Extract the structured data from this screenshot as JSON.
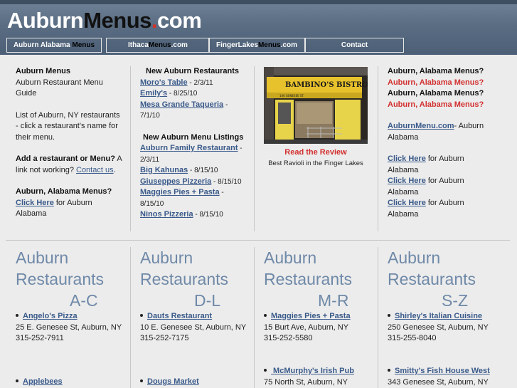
{
  "site": {
    "logo_part1": "Auburn",
    "logo_part2": "Menus",
    "logo_dot": ".",
    "logo_part3": "com"
  },
  "nav": [
    {
      "a": "Auburn ",
      "b": "Alabama ",
      "c": "Menus",
      "d": ""
    },
    {
      "a": "Ithaca",
      "b": "Menus",
      "c": ".com",
      "d": ""
    },
    {
      "a": "FingerLakes",
      "b": "Menus",
      "c": ".com",
      "d": ""
    },
    {
      "a": "Contact",
      "b": "",
      "c": "",
      "d": ""
    }
  ],
  "intro": {
    "title": "Auburn Menus",
    "subtitle": "Auburn Restaurant Menu Guide",
    "list_text": "List of Auburn, NY restaurants - click a restaurant's name for their menu.",
    "add_bold": "Add a restaurant or Menu?",
    "add_text": " A link not working? ",
    "contact_link": "Contact us",
    "period": ".",
    "alabama_bold": "Auburn, Alabama Menus?",
    "click_here": "Click Here",
    "for_auburn_alabama": " for Auburn Alabama"
  },
  "new_restaurants": {
    "heading": "New Auburn Restaurants",
    "items": [
      {
        "name": "Moro's Table",
        "date": " - 2/3/11"
      },
      {
        "name": "Emily's",
        "date": " - 8/25/10"
      },
      {
        "name": "Mesa Grande Taqueria",
        "date": " - 7/1/10"
      }
    ]
  },
  "new_listings": {
    "heading": "New Auburn Menu Listings",
    "items": [
      {
        "name": "Auburn Family Restaurant",
        "date": " - 2/3/11"
      },
      {
        "name": "Big Kahunas",
        "date": " - 8/15/10"
      },
      {
        "name": "Giuseppes Pizzeria",
        "date": " - 8/15/10"
      },
      {
        "name": "Maggies Pies + Pasta",
        "date": " - 8/15/10"
      },
      {
        "name": "Ninos Pizzeria",
        "date": " - 8/15/10"
      }
    ]
  },
  "feature": {
    "sign_text": "BAMBINO'S BISTRO",
    "sign_small": "106 GENESEE ST.",
    "review_link": "Read the Review",
    "caption": "Best Ravioli in the Finger Lakes"
  },
  "right": {
    "q1": "Auburn, Alabama Menus?",
    "q2": "Auburn, Alabama Menus?",
    "q3": "Auburn, Alabama Menus?",
    "q4": "Auburn, Alabama Menus?",
    "link_site": "AuburnMenu.com",
    "link_site_rest": "- Auburn Alabama",
    "click_here": "Click Here",
    "for_auburn_alabama": " for Auburn Alabama"
  },
  "categories": [
    {
      "line1": "Auburn",
      "line2": "Restaurants",
      "range": "A-C",
      "items": [
        {
          "name": "Angelo's Pizza",
          "addr": "25 E. Genesee St, Auburn, NY",
          "phone": "315-252-7911"
        },
        {
          "name": "Applebees",
          "addr": "",
          "phone": ""
        }
      ]
    },
    {
      "line1": "Auburn",
      "line2": "Restaurants",
      "range": "D-L",
      "items": [
        {
          "name": "Dauts Restaurant",
          "addr": "10 E. Genesee St, Auburn, NY",
          "phone": "315-252-7175"
        },
        {
          "name": "Dougs Market",
          "addr": "",
          "phone": ""
        }
      ]
    },
    {
      "line1": "Auburn",
      "line2": "Restaurants",
      "range": "M-R",
      "items": [
        {
          "name": "Maggies Pies + Pasta",
          "addr": "15 Burt Ave, Auburn, NY",
          "phone": "315-252-5580"
        },
        {
          "name": " McMurphy's Irish Pub",
          "addr": "75 North St, Auburn, NY",
          "phone": ""
        }
      ]
    },
    {
      "line1": "Auburn",
      "line2": "Restaurants",
      "range": "S-Z",
      "items": [
        {
          "name": "Shirley's Italian Cuisine",
          "addr": "250 Genesee St, Auburn, NY",
          "phone": "315-255-8040"
        },
        {
          "name": "Smitty's Fish House West",
          "addr": "343 Genesee St, Auburn, NY",
          "phone": ""
        }
      ]
    }
  ]
}
